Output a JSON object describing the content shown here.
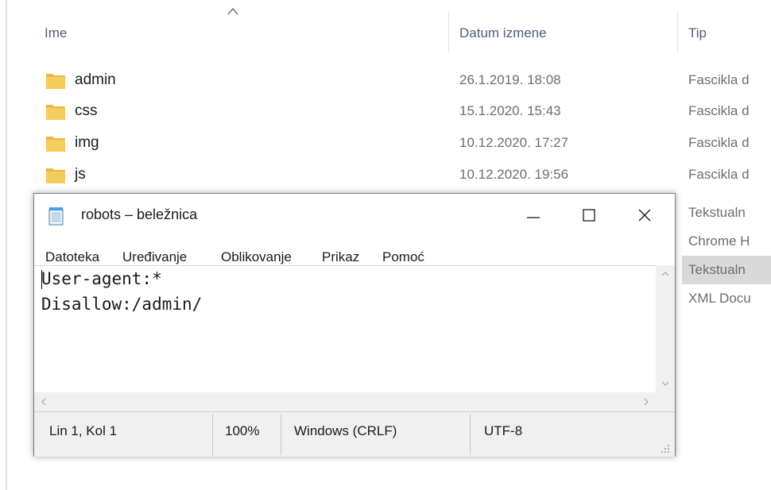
{
  "explorer": {
    "columns": {
      "name": "Ime",
      "date": "Datum izmene",
      "type": "Tip"
    },
    "rows": [
      {
        "name": "admin",
        "date": "26.1.2019. 18:08",
        "type": "Fascikla d"
      },
      {
        "name": "css",
        "date": "15.1.2020. 15:43",
        "type": "Fascikla d"
      },
      {
        "name": "img",
        "date": "10.12.2020. 17:27",
        "type": "Fascikla d"
      },
      {
        "name": "js",
        "date": "10.12.2020. 19:56",
        "type": "Fascikla d"
      }
    ],
    "partial_types": [
      "Tekstualn",
      "Chrome H",
      "Tekstualn",
      "XML Docu"
    ],
    "folder_color": "#e8b744"
  },
  "notepad": {
    "title": "robots – beležnica",
    "menu": [
      "Datoteka",
      "Uređivanje",
      "Oblikovanje",
      "Prikaz",
      "Pomoć"
    ],
    "content_lines": [
      "User-agent:*",
      "Disallow:/admin/"
    ],
    "status": {
      "position": "Lin 1, Kol 1",
      "zoom": "100%",
      "line_ending": "Windows (CRLF)",
      "encoding": "UTF-8"
    }
  }
}
